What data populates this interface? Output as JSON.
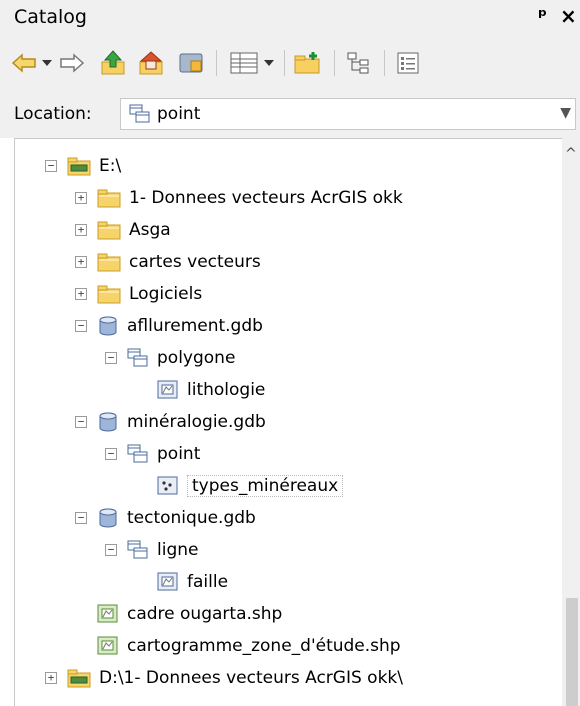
{
  "window": {
    "title": "Catalog",
    "pin_glyph": "ᵖ",
    "close_glyph": "×"
  },
  "toolbar": {
    "items": [
      {
        "name": "back-arrow-icon"
      },
      {
        "name": "back-dropdown-icon"
      },
      {
        "name": "forward-arrow-icon"
      },
      {
        "name": "up-one-level-icon"
      },
      {
        "name": "home-folder-icon"
      },
      {
        "name": "toggle-contents-panel-icon"
      },
      {
        "name": "views-icon"
      },
      {
        "name": "views-dropdown-icon"
      },
      {
        "name": "connect-folder-icon"
      },
      {
        "name": "tree-options-icon"
      },
      {
        "name": "list-options-icon"
      }
    ]
  },
  "location": {
    "label": "Location:",
    "value": "point",
    "icon": "feature-dataset-icon"
  },
  "tree": [
    {
      "label": "E:\\",
      "icon": "folder-drive-icon",
      "expander": "minus",
      "depth": 0
    },
    {
      "label": "1- Donnees vecteurs AcrGIS okk",
      "icon": "folder-icon",
      "expander": "plus",
      "depth": 1
    },
    {
      "label": "Asga",
      "icon": "folder-icon",
      "expander": "plus",
      "depth": 1
    },
    {
      "label": "cartes vecteurs",
      "icon": "folder-icon",
      "expander": "plus",
      "depth": 1
    },
    {
      "label": "Logiciels",
      "icon": "folder-icon",
      "expander": "plus",
      "depth": 1
    },
    {
      "label": "afllurement.gdb",
      "icon": "geodatabase-icon",
      "expander": "minus",
      "depth": 1
    },
    {
      "label": "polygone",
      "icon": "feature-dataset-icon",
      "expander": "minus",
      "depth": 2
    },
    {
      "label": "lithologie",
      "icon": "polygon-feature-class-icon",
      "expander": "none",
      "depth": 3
    },
    {
      "label": "minéralogie.gdb",
      "icon": "geodatabase-icon",
      "expander": "minus",
      "depth": 1
    },
    {
      "label": "point",
      "icon": "feature-dataset-icon",
      "expander": "minus",
      "depth": 2
    },
    {
      "label": "types_minéreaux",
      "icon": "point-feature-class-icon",
      "expander": "none",
      "depth": 3,
      "selected": true
    },
    {
      "label": "tectonique.gdb",
      "icon": "geodatabase-icon",
      "expander": "minus",
      "depth": 1
    },
    {
      "label": "ligne",
      "icon": "feature-dataset-icon",
      "expander": "minus",
      "depth": 2
    },
    {
      "label": "faille",
      "icon": "polygon-feature-class-icon",
      "expander": "none",
      "depth": 3
    },
    {
      "label": "cadre ougarta.shp",
      "icon": "shapefile-polygon-icon",
      "expander": "none",
      "depth": 1
    },
    {
      "label": "cartogramme_zone_d'étude.shp",
      "icon": "shapefile-polygon-icon",
      "expander": "none",
      "depth": 1
    },
    {
      "label": "D:\\1- Donnees vecteurs AcrGIS okk\\",
      "icon": "folder-drive-icon",
      "expander": "plus",
      "depth": 0
    }
  ]
}
